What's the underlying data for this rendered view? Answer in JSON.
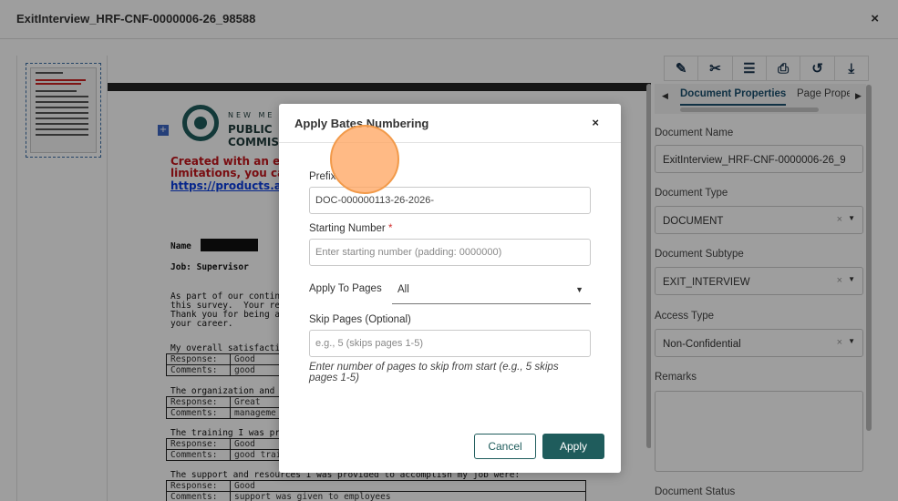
{
  "window": {
    "title": "ExitInterview_HRF-CNF-0000006-26_98588",
    "close_icon": "×"
  },
  "document": {
    "org_line1": "NEW ME",
    "org_line2": "PUBLIC",
    "org_line3": "COMMIS",
    "red_line1": "Created with an ev",
    "red_line2": "limitations, you ca",
    "link": "https://products.asp",
    "name_label": "Name",
    "job": "Job: Supervisor",
    "para1": "As part of our continuous",
    "para2": "this survey.  Your respo",
    "para3": "Thank you for being a m",
    "para4": "your career.",
    "q1": "My overall satisfaction w",
    "q2": "The organization and ma",
    "q3": "The training I was provid",
    "q4": "The support and resources I was provided to accomplish my job were:",
    "response_label": "Response:",
    "comments_label": "Comments:",
    "rows": [
      {
        "response": "Good",
        "comments": "good"
      },
      {
        "response": "Great",
        "comments": "manageme"
      },
      {
        "response": "Good",
        "comments": "good traini"
      },
      {
        "response": "Good",
        "comments": "support was given to employees"
      }
    ]
  },
  "right_panel": {
    "tab_active": "Document Properties",
    "tab_next": "Page Prope",
    "fields": [
      {
        "label": "Document Name",
        "value": "ExitInterview_HRF-CNF-0000006-26_9"
      },
      {
        "label": "Document Type",
        "value": "DOCUMENT"
      },
      {
        "label": "Document Subtype",
        "value": "EXIT_INTERVIEW"
      },
      {
        "label": "Access Type",
        "value": "Non-Confidential"
      },
      {
        "label": "Remarks",
        "value": ""
      },
      {
        "label": "Document Status",
        "value": ""
      }
    ]
  },
  "modal": {
    "title": "Apply Bates Numbering",
    "close": "×",
    "prefix_label": "Prefix",
    "prefix_value": "DOC-000000113-26-2026-",
    "starting_label": "Starting Number",
    "required_mark": "*",
    "starting_placeholder": "Enter starting number (padding: 0000000)",
    "apply_to_label": "Apply To Pages",
    "apply_to_value": "All",
    "skip_label": "Skip Pages (Optional)",
    "skip_placeholder": "e.g., 5 (skips pages 1-5)",
    "helper": "Enter number of pages to skip from start (e.g., 5 skips pages 1-5)",
    "cancel": "Cancel",
    "apply": "Apply"
  }
}
